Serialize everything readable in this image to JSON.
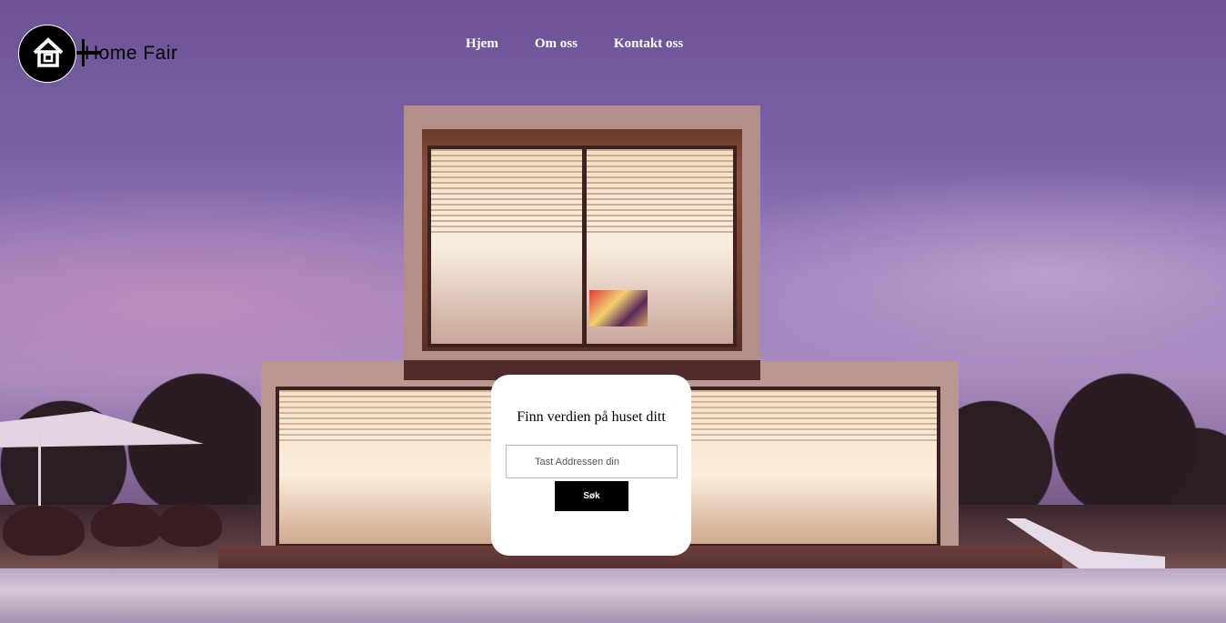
{
  "brand": {
    "name": "Home Fair"
  },
  "nav": {
    "items": [
      {
        "label": "Hjem"
      },
      {
        "label": "Om oss"
      },
      {
        "label": "Kontakt oss"
      }
    ]
  },
  "search": {
    "title": "Finn verdien på huset ditt",
    "placeholder": "Tast Addressen din",
    "value": "",
    "button_label": "Søk"
  },
  "icons": {
    "logo": "house-icon"
  },
  "colors": {
    "nav_text": "#ffffff",
    "button_bg": "#000000",
    "card_bg": "#ffffff",
    "sky": "#7b62a6"
  }
}
